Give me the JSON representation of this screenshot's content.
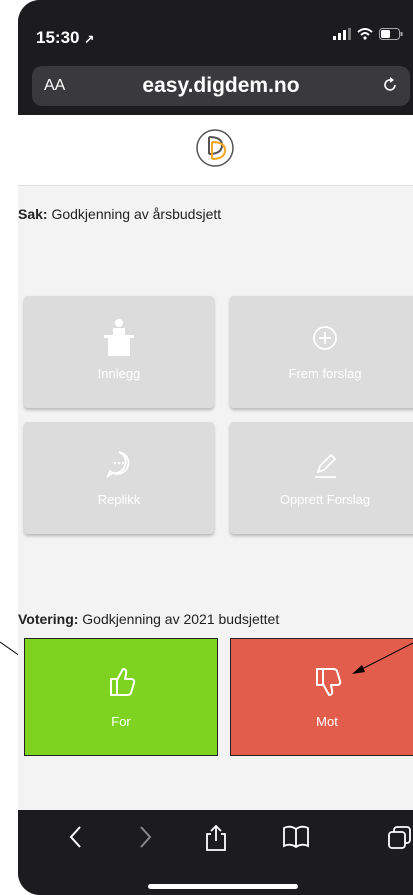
{
  "status_bar": {
    "time": "15:30"
  },
  "browser": {
    "text_size_label": "AA",
    "url": "easy.digdem.no"
  },
  "page": {
    "sak": {
      "label": "Sak:",
      "text": " Godkjenning av årsbudsjett"
    },
    "tiles": [
      {
        "label": "Innlegg",
        "icon": "podium-icon"
      },
      {
        "label": "Frem forslag",
        "icon": "plus-circle-icon"
      },
      {
        "label": "Replikk",
        "icon": "chat-bubble-icon"
      },
      {
        "label": "Opprett Forslag",
        "icon": "pencil-icon"
      }
    ],
    "votering": {
      "label": "Votering:",
      "text": " Godkjenning av 2021 budsjettet"
    },
    "vote_for": {
      "label": "For",
      "color": "#7ed321"
    },
    "vote_against": {
      "label": "Mot",
      "color": "#e35d4d"
    }
  },
  "colors": {
    "tile_bg": "#dcdcdc",
    "page_bg": "#f3f3f3",
    "logo_orange": "#f5a623"
  }
}
